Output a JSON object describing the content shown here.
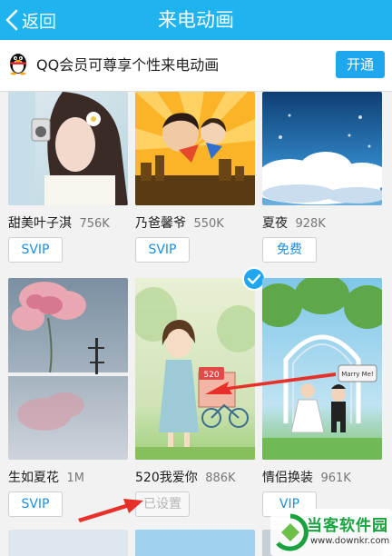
{
  "header": {
    "back_label": "返回",
    "title": "来电动画"
  },
  "promo": {
    "text": "QQ会员可尊享个性来电动画",
    "button_label": "开通"
  },
  "row1": [
    {
      "name": "甜美叶子淇",
      "size": "756K",
      "tag": "SVIP"
    },
    {
      "name": "乃爸馨爷",
      "size": "550K",
      "tag": "SVIP"
    },
    {
      "name": "夏夜",
      "size": "928K",
      "tag": "免费"
    }
  ],
  "row2": [
    {
      "name": "生如夏花",
      "size": "1M",
      "tag": "SVIP"
    },
    {
      "name": "520我爱你",
      "size": "886K",
      "tag": "已设置",
      "selected": true,
      "sign_text": "520"
    },
    {
      "name": "情侣换装",
      "size": "961K",
      "tag": "VIP",
      "sign_text": "Marry Me!"
    }
  ],
  "watermark": {
    "title": "当客软件园",
    "url": "www.downkr.com"
  }
}
